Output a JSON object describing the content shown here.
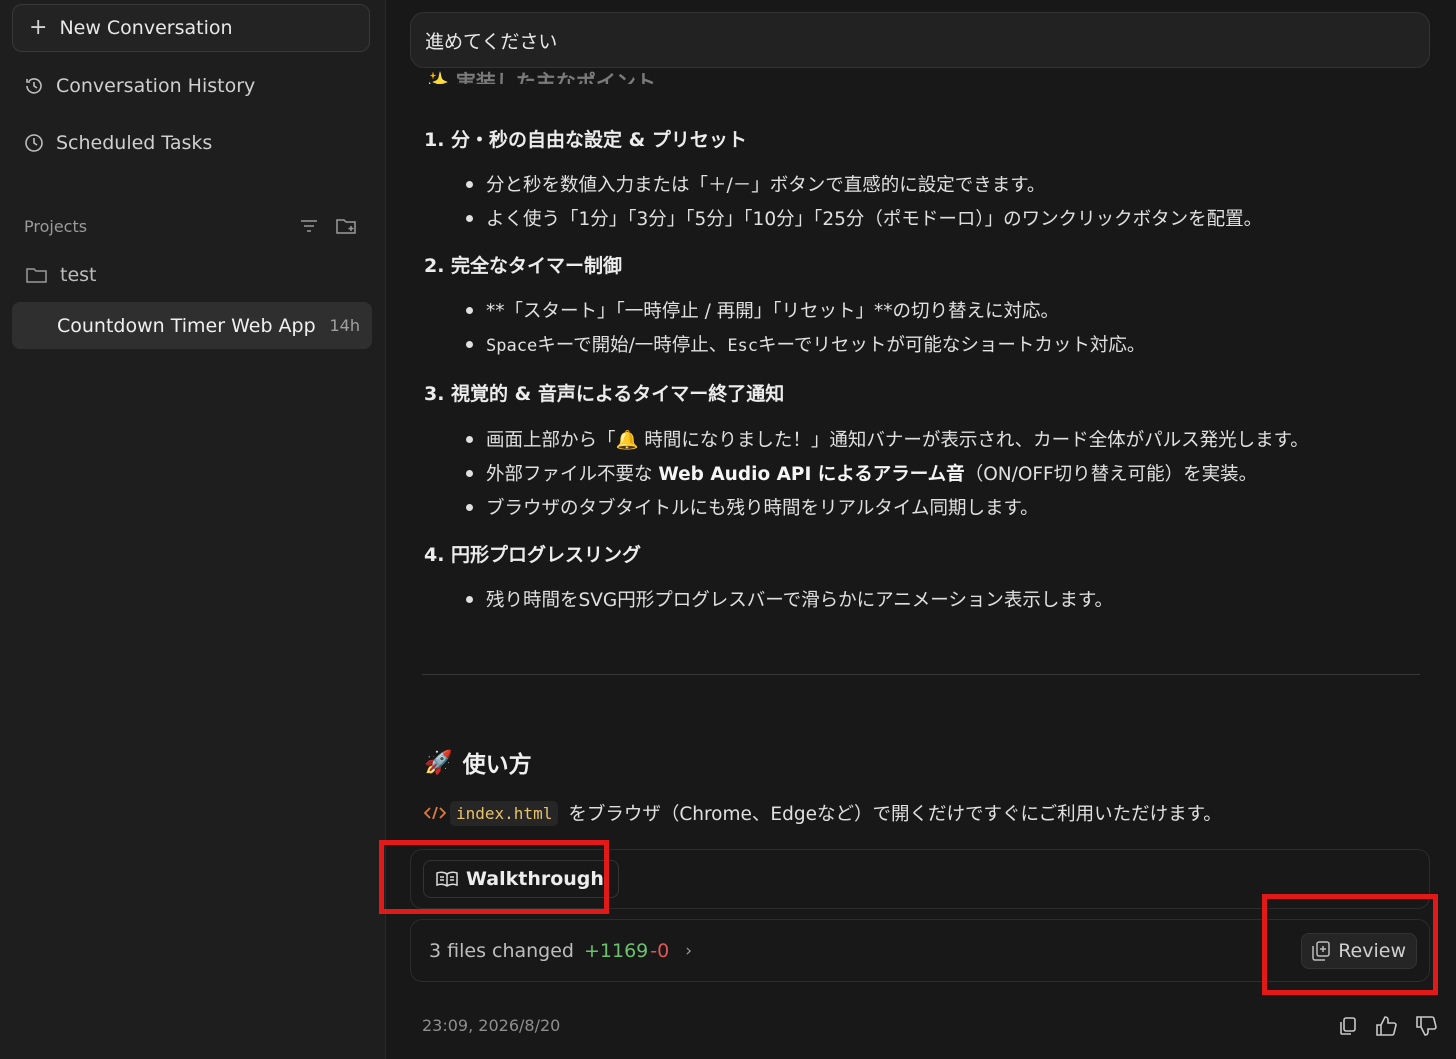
{
  "sidebar": {
    "new_conversation": "New Conversation",
    "history": "Conversation History",
    "scheduled": "Scheduled Tasks",
    "projects_label": "Projects",
    "folder_name": "test",
    "active_item": {
      "label": "Countdown Timer Web App",
      "age": "14h"
    }
  },
  "main": {
    "input_text": "進めてください",
    "cut_heading": "✨ 実装した主なポイント",
    "sections": [
      {
        "title": "1. 分・秒の自由な設定 & プリセット",
        "bullets": [
          "分と秒を数値入力または「＋/－」ボタンで直感的に設定できます。",
          "よく使う「1分」「3分」「5分」「10分」「25分（ポモドーロ）」のワンクリックボタンを配置。"
        ]
      },
      {
        "title": "2. 完全なタイマー制御",
        "bullets": [
          "**「スタート」「一時停止 / 再開」「リセット」**の切り替えに対応。",
          {
            "mono1": "Space",
            "mid": "キーで開始/一時停止、",
            "mono2": "Esc",
            "end": "キーでリセットが可能なショートカット対応。"
          }
        ]
      },
      {
        "title": "3. 視覚的 & 音声によるタイマー終了通知",
        "bullets": [
          "画面上部から「🔔 時間になりました！」通知バナーが表示され、カード全体がパルス発光します。",
          {
            "pre": "外部ファイル不要な ",
            "strong": "Web Audio API によるアラーム音",
            "post": "（ON/OFF切り替え可能）を実装。"
          },
          "ブラウザのタブタイトルにも残り時間をリアルタイム同期します。"
        ]
      },
      {
        "title": "4. 円形プログレスリング",
        "bullets": [
          "残り時間をSVG円形プログレスバーで滑らかにアニメーション表示します。"
        ]
      }
    ],
    "usage": {
      "emoji": "🚀",
      "heading": "使い方",
      "file": "index.html",
      "text": "をブラウザ（Chrome、Edgeなど）で開くだけですぐにご利用いただけます。"
    },
    "walkthrough_label": "Walkthrough",
    "files": {
      "changed": "3 files changed",
      "added": "+1169",
      "removed": "-0"
    },
    "review_label": "Review",
    "timestamp": "23:09, 2026/8/20"
  },
  "colors": {
    "highlight": "#e11919",
    "added": "#6cc070",
    "removed": "#e05555"
  }
}
